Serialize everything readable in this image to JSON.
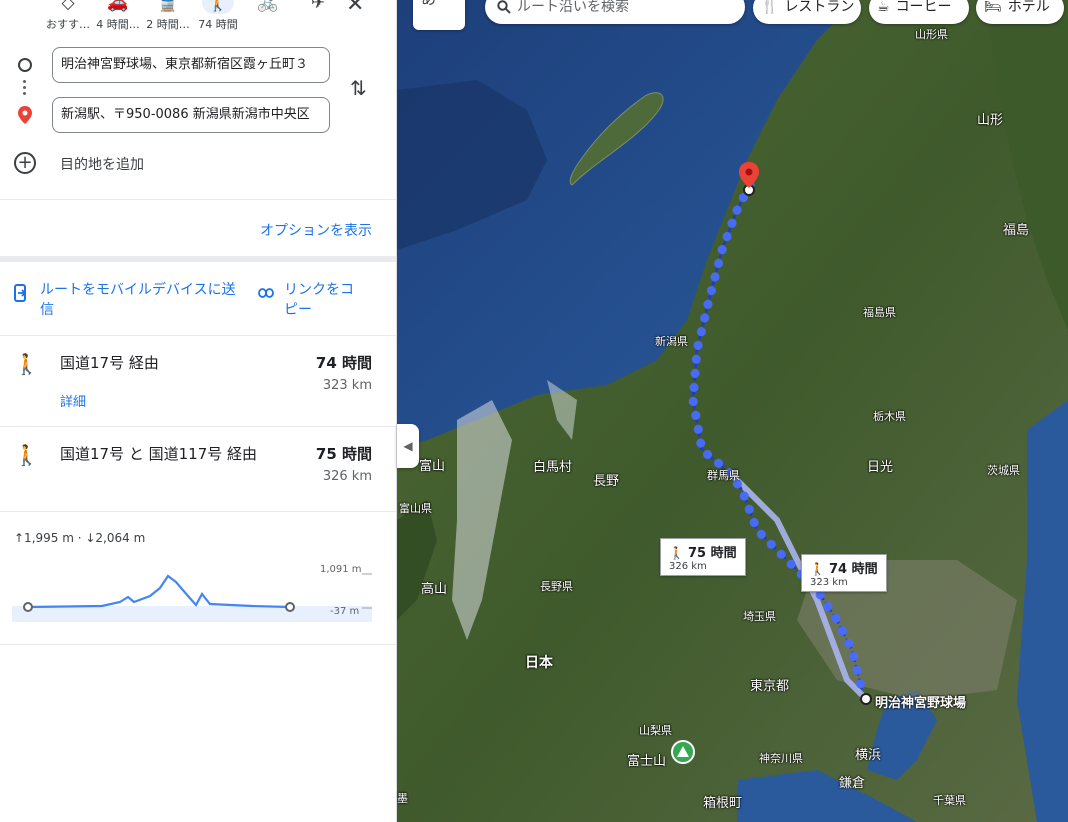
{
  "travel_modes": [
    {
      "icon": "recommended-icon",
      "glyph": "◇",
      "label": "おすす…"
    },
    {
      "icon": "car-icon",
      "glyph": "🚗",
      "label": "4 時間…"
    },
    {
      "icon": "transit-icon",
      "glyph": "🚆",
      "label": "2 時間…"
    },
    {
      "icon": "walk-icon",
      "glyph": "🚶",
      "label": "74 時間",
      "active": true
    },
    {
      "icon": "bicycle-icon",
      "glyph": "🚲",
      "label": ""
    },
    {
      "icon": "flight-icon",
      "glyph": "✈",
      "label": ""
    }
  ],
  "directions": {
    "origin": "明治神宮野球場、東京都新宿区霞ヶ丘町３",
    "destination": "新潟駅、〒950-0086 新潟県新潟市中央区",
    "add_destination": "目的地を追加",
    "options_link": "オプションを表示",
    "send_to_device": "ルートをモバイルデバイスに送信",
    "copy_link": "リンクをコピー"
  },
  "routes": [
    {
      "name": "国道17号 経由",
      "time": "74 時間",
      "distance": "323 km",
      "details": "詳細"
    },
    {
      "name": "国道17号 と 国道117号 経由",
      "time": "75 時間",
      "distance": "326 km"
    }
  ],
  "elevation": {
    "summary": "↑1,995 m · ↓2,064 m",
    "max_label": "1,091 m",
    "min_label": "-37 m"
  },
  "map": {
    "ime_label": "あ",
    "search_placeholder": "ルート沿いを検索",
    "chips": [
      {
        "icon": "restaurant-icon",
        "glyph": "🍴",
        "label": "レストラン"
      },
      {
        "icon": "coffee-icon",
        "glyph": "☕",
        "label": "コーヒー"
      },
      {
        "icon": "hotel-icon",
        "glyph": "🛏",
        "label": "ホテル"
      }
    ],
    "labels": {
      "yamagata_pref": "山形県",
      "yamagata": "山形",
      "fukushima": "福島",
      "fukushima_pref": "福島県",
      "niigata_pref": "新潟県",
      "tochigi_pref": "栃木県",
      "hakuba": "白馬村",
      "nagano": "長野",
      "gunma_pref": "群馬県",
      "nikko": "日光",
      "ibaraki_pref": "茨城県",
      "toyama": "富山",
      "toyama_pref": "富山県",
      "takayama": "高山",
      "nagano_pref": "長野県",
      "saitama_pref": "埼玉県",
      "japan": "日本",
      "tokyo_metro": "東京都",
      "meiji_jingu": "明治神宮野球場",
      "yamanashi_pref": "山梨県",
      "yokohama": "横浜",
      "fujisan": "富士山",
      "kanagawa_pref": "神奈川県",
      "kamakura": "鎌倉",
      "hakone": "箱根町",
      "chiba_pref": "千葉県",
      "left_edge": "墨"
    },
    "bubbles": [
      {
        "time": "75 時間",
        "distance": "326 km"
      },
      {
        "time": "74 時間",
        "distance": "323 km"
      }
    ]
  }
}
